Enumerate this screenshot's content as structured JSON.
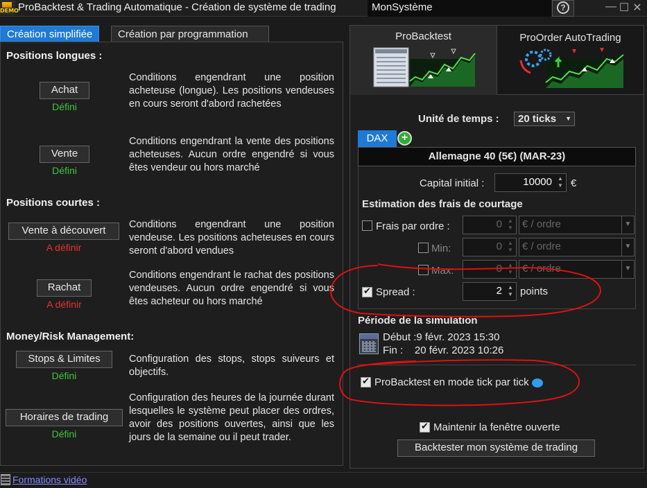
{
  "window": {
    "title": "ProBacktest & Trading Automatique - Création de système de trading",
    "system_name": "MonSystème",
    "demo_badge": "DEMO",
    "help": "?",
    "minimize": "—",
    "maximize": "☐",
    "close": "✕"
  },
  "left": {
    "tabs": [
      {
        "label": "Création simplifiée"
      },
      {
        "label": "Création par programmation"
      }
    ],
    "long_title": "Positions longues :",
    "short_title": "Positions courtes :",
    "mm_title": "Money/Risk Management:",
    "items": [
      {
        "button": "Achat",
        "status": "Défini",
        "desc": "Conditions engendrant une position acheteuse (longue). Les positions vendeuses en cours seront d'abord rachetées"
      },
      {
        "button": "Vente",
        "status": "Défini",
        "desc": "Conditions engendrant la vente des positions acheteuses. Aucun ordre engendré si vous êtes vendeur ou hors marché"
      },
      {
        "button": "Vente à découvert",
        "status": "A définir",
        "desc": "Conditions engendrant une position vendeuse. Les positions acheteuses en cours seront d'abord vendues"
      },
      {
        "button": "Rachat",
        "status": "A définir",
        "desc": "Conditions engendrant le rachat des positions vendeuses. Aucun ordre engendré si vous êtes acheteur ou hors marché"
      },
      {
        "button": "Stops & Limites",
        "status": "Défini",
        "desc": "Configuration des stops, stops suiveurs et objectifs."
      },
      {
        "button": "Horaires de trading",
        "status": "Défini",
        "desc": "Configuration des heures de la journée durant lesquelles le système peut placer des ordres, avoir des positions ouvertes, ainsi que les jours de la semaine ou il peut trader."
      }
    ]
  },
  "right": {
    "tabs": [
      {
        "label": "ProBacktest"
      },
      {
        "label": "ProOrder AutoTrading"
      }
    ],
    "timeframe_label": "Unité de temps :",
    "timeframe_value": "20 ticks",
    "instrument_tab": "DAX",
    "instrument_add": "+",
    "instrument_name": "Allemagne 40 (5€) (MAR-23)",
    "capital_label": "Capital initial :",
    "capital_value": "10000",
    "currency": "€",
    "fees_title": "Estimation des frais de courtage",
    "fees_per_order_label": "Frais par ordre :",
    "fees_per_order_value": "0",
    "fees_unit": "€ / ordre",
    "min_label": "Min:",
    "min_value": "0",
    "min_unit": "€ / ordre",
    "max_label": "Max:",
    "max_value": "0",
    "max_unit": "€ / ordre",
    "spread_label": "Spread :",
    "spread_value": "2",
    "spread_unit": "points",
    "period_title": "Période de la simulation",
    "start_label": "Début :",
    "start_value": "9 févr. 2023 15:30",
    "end_label": "Fin :",
    "end_value": "20 févr. 2023 10:26",
    "tick_mode_label": "ProBacktest en mode tick par tick",
    "keep_open_label": "Maintenir la fenêtre ouverte",
    "backtest_button": "Backtester mon système de trading"
  },
  "footer": {
    "link": "Formations vidéo"
  },
  "colors": {
    "accent": "#1f7ad6",
    "defined": "#3ec83e",
    "undefined": "#e83232",
    "annotation": "#e01010"
  }
}
